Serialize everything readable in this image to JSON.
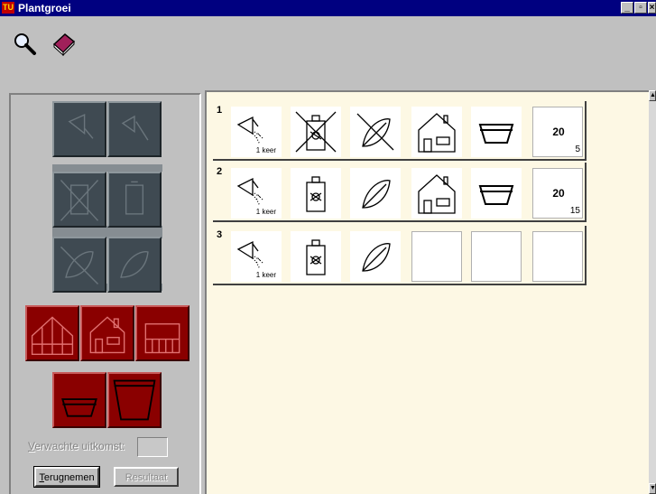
{
  "window": {
    "title": "Plantgroei",
    "app_icon": "tu-logo",
    "buttons": [
      "_",
      "▫",
      "×"
    ]
  },
  "toolbar": {
    "items": [
      {
        "name": "magnifier-icon"
      },
      {
        "name": "book-icon"
      }
    ]
  },
  "left_panel": {
    "expected_label_prefix": "V",
    "expected_label_rest": "erwachte uitkomst:",
    "expected_value": "",
    "undo_label_prefix": "T",
    "undo_label_rest": "erugnemen",
    "result_label": "Resultaat"
  },
  "rows": [
    {
      "number": "1",
      "water_caption": "1 keer",
      "big": "20",
      "small": "5"
    },
    {
      "number": "2",
      "water_caption": "1 keer",
      "big": "20",
      "small": "15"
    },
    {
      "number": "3",
      "water_caption": "1 keer",
      "big": "",
      "small": ""
    }
  ],
  "colors": {
    "title_bar": "#000080",
    "canvas": "#fdf8e4",
    "selected_red": "#8a0000",
    "disabled_grey": "#3f4a52"
  }
}
